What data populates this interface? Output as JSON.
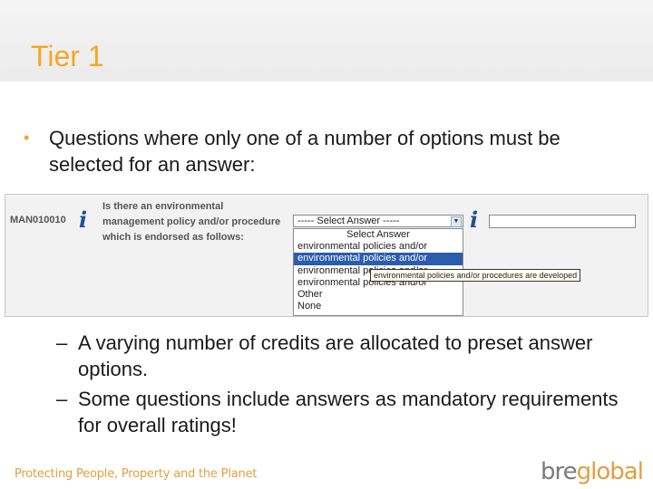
{
  "slide": {
    "title": "Tier 1",
    "bullet": "Questions where only one of a number of options must be selected for an answer:",
    "sub_bullets": [
      "A varying number of credits are allocated to preset answer options.",
      "Some questions include answers as mandatory requirements for overall ratings!"
    ],
    "footer_tagline": "Protecting People, Property and the Planet",
    "logo": {
      "part1": "bre",
      "part2": "global"
    }
  },
  "form": {
    "row_id": "MAN010010",
    "info_icon": "i",
    "question": "Is there an environmental management policy and/or procedure which is endorsed as follows:",
    "select_value": "----- Select Answer -----",
    "options": [
      "Select Answer",
      "environmental policies and/or",
      "environmental policies and/or",
      "environmental policies and/or",
      "environmental policies and/or",
      "Other",
      "None"
    ],
    "highlighted_option_index": 2,
    "tooltip": "environmental policies and/or procedures are developed",
    "answer_field": ""
  },
  "icons": {
    "info": "info-icon",
    "dropdown": "chevron-down-icon",
    "bullet": "bullet-dot-icon"
  },
  "colors": {
    "title": "#f5a623",
    "info_icon": "#1f4e9a",
    "highlight": "#2b5cad",
    "accent": "#e0a040"
  }
}
